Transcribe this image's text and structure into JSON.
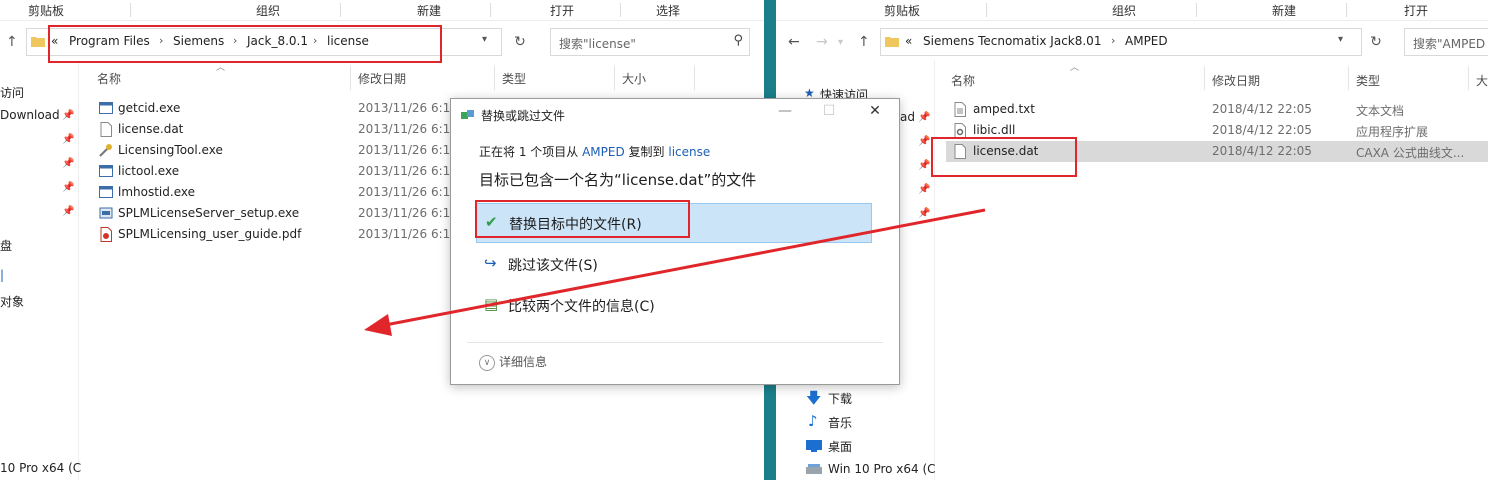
{
  "left": {
    "ribbon": [
      "剪贴板",
      "组织",
      "新建",
      "打开",
      "选择"
    ],
    "address": [
      "Program Files",
      "Siemens",
      "Jack_8.0.1",
      "license"
    ],
    "address_prefix": "«",
    "search_placeholder": "搜索\"license\"",
    "columns": [
      "名称",
      "修改日期",
      "类型",
      "大小"
    ],
    "nav": [
      "访问",
      "Download",
      "盘",
      "对象",
      "10 Pro x64 (C"
    ],
    "files": [
      {
        "name": "getcid.exe",
        "date": "2013/11/26 6:18",
        "icon": "exe-window-icon"
      },
      {
        "name": "license.dat",
        "date": "2013/11/26 6:18",
        "icon": "blank-file-icon"
      },
      {
        "name": "LicensingTool.exe",
        "date": "2013/11/26 6:18",
        "icon": "tool-icon"
      },
      {
        "name": "lictool.exe",
        "date": "2013/11/26 6:18",
        "icon": "exe-window-icon"
      },
      {
        "name": "lmhostid.exe",
        "date": "2013/11/26 6:18",
        "icon": "exe-window-icon"
      },
      {
        "name": "SPLMLicenseServer_setup.exe",
        "date": "2013/11/26 6:18",
        "icon": "installer-icon"
      },
      {
        "name": "SPLMLicensing_user_guide.pdf",
        "date": "2013/11/26 6:18",
        "icon": "pdf-icon"
      }
    ]
  },
  "right": {
    "ribbon": [
      "剪贴板",
      "组织",
      "新建",
      "打开"
    ],
    "address": [
      "Siemens Tecnomatix Jack8.01",
      "AMPED"
    ],
    "address_prefix": "«",
    "search_placeholder": "搜索\"AMPED",
    "columns": [
      "名称",
      "修改日期",
      "类型",
      "大"
    ],
    "nav": [
      {
        "label": "快速访问",
        "icon": "star-icon"
      },
      {
        "label": "ad",
        "icon": ""
      },
      {
        "label": "下载",
        "icon": "download-arrow-icon"
      },
      {
        "label": "音乐",
        "icon": "music-note-icon"
      },
      {
        "label": "桌面",
        "icon": "desktop-icon"
      },
      {
        "label": "Win 10 Pro x64 (C",
        "icon": "drive-icon"
      }
    ],
    "files": [
      {
        "name": "amped.txt",
        "date": "2018/4/12 22:05",
        "type": "文本文档",
        "icon": "text-file-icon"
      },
      {
        "name": "libic.dll",
        "date": "2018/4/12 22:05",
        "type": "应用程序扩展",
        "icon": "dll-gear-icon"
      },
      {
        "name": "license.dat",
        "date": "2018/4/12 22:05",
        "type": "CAXA 公式曲线文...",
        "icon": "blank-file-icon",
        "selected": true
      }
    ]
  },
  "dialog": {
    "title": "替换或跳过文件",
    "sub_prefix": "正在将 1 个项目从 ",
    "sub_src": "AMPED",
    "sub_mid": " 复制到 ",
    "sub_dst": "license",
    "heading": "目标已包含一个名为“license.dat”的文件",
    "options": [
      {
        "label": "替换目标中的文件(R)",
        "icon": "✔",
        "icon_name": "checkmark-icon",
        "color": "#2e9e46"
      },
      {
        "label": "跳过该文件(S)",
        "icon": "↪",
        "icon_name": "skip-arrow-icon",
        "color": "#1c5fb5"
      },
      {
        "label": "比较两个文件的信息(C)",
        "icon": "▤",
        "icon_name": "compare-files-icon",
        "color": "#4a8a3a"
      }
    ],
    "more": "详细信息",
    "minimize": "—",
    "maximize": "☐",
    "close": "✕"
  },
  "colors": {
    "annotation": "#e0262a",
    "highlight": "#cce4f7",
    "link": "#1c5fb5"
  }
}
